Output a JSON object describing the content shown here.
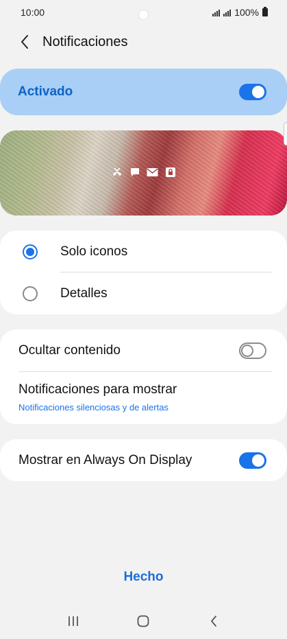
{
  "status_bar": {
    "time": "10:00",
    "battery": "100%"
  },
  "header": {
    "title": "Notificaciones"
  },
  "master": {
    "label": "Activado",
    "enabled": true
  },
  "preview": {
    "icons": [
      "missed-call-icon",
      "message-icon",
      "email-icon",
      "lock-icon"
    ]
  },
  "style_options": [
    {
      "label": "Solo iconos",
      "selected": true
    },
    {
      "label": "Detalles",
      "selected": false
    }
  ],
  "hide_content": {
    "label": "Ocultar contenido",
    "enabled": false
  },
  "notifications_to_show": {
    "label": "Notificaciones para mostrar",
    "value": "Notificaciones silenciosas y de alertas"
  },
  "aod": {
    "label": "Mostrar en Always On Display",
    "enabled": true
  },
  "done_label": "Hecho",
  "colors": {
    "accent": "#1a73e8",
    "master_bg": "#a9cff6",
    "page_bg": "#f2f2f2"
  }
}
